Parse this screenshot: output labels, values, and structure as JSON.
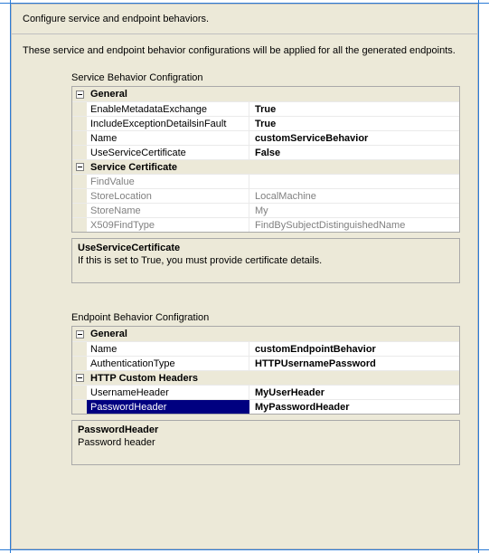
{
  "header": "Configure service and endpoint behaviors.",
  "intro": "These service and endpoint behavior configurations will be applied for all the generated endpoints.",
  "service_section": {
    "title": "Service Behavior Configration",
    "categories": [
      {
        "label": "General",
        "rows": [
          {
            "key": "EnableMetadataExchange",
            "val": "True",
            "bold": true
          },
          {
            "key": "IncludeExceptionDetailsinFault",
            "val": "True",
            "bold": true
          },
          {
            "key": "Name",
            "val": "customServiceBehavior",
            "bold": true
          },
          {
            "key": "UseServiceCertificate",
            "val": "False",
            "bold": true
          }
        ]
      },
      {
        "label": "Service Certificate",
        "disabled": true,
        "rows": [
          {
            "key": "FindValue",
            "val": ""
          },
          {
            "key": "StoreLocation",
            "val": "LocalMachine"
          },
          {
            "key": "StoreName",
            "val": "My"
          },
          {
            "key": "X509FindType",
            "val": "FindBySubjectDistinguishedName"
          }
        ]
      }
    ],
    "desc": {
      "title": "UseServiceCertificate",
      "body": "If this is set to True, you must provide certificate details."
    }
  },
  "endpoint_section": {
    "title": "Endpoint Behavior Configration",
    "categories": [
      {
        "label": "General",
        "rows": [
          {
            "key": "Name",
            "val": "customEndpointBehavior",
            "bold": true
          },
          {
            "key": "AuthenticationType",
            "val": "HTTPUsernamePassword",
            "bold": true
          }
        ]
      },
      {
        "label": "HTTP Custom Headers",
        "rows": [
          {
            "key": "UsernameHeader",
            "val": "MyUserHeader",
            "bold": true
          },
          {
            "key": "PasswordHeader",
            "val": "MyPasswordHeader",
            "bold": true,
            "selected": true
          }
        ]
      }
    ],
    "desc": {
      "title": "PasswordHeader",
      "body": "Password header"
    }
  }
}
